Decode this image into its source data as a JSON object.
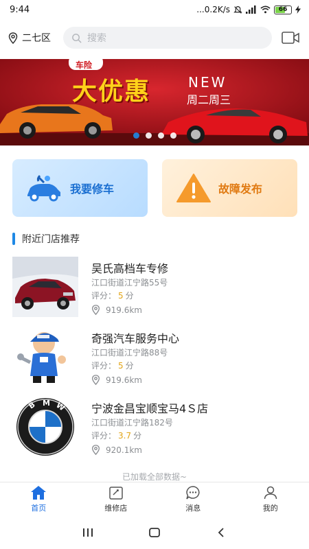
{
  "status": {
    "time": "9:44",
    "speed": "...0.2K/s",
    "battery": "66",
    "battery_level": 0.66
  },
  "topbar": {
    "location": "二七区",
    "search_placeholder": "搜索"
  },
  "banner": {
    "tag": "车险",
    "headline": "大优惠",
    "new_text": "NEW",
    "days": "周二周三",
    "slide_count": 4,
    "active_slide": 0
  },
  "actions": {
    "repair_label": "我要修车",
    "fault_label": "故障发布"
  },
  "section": {
    "title": "附近门店推荐"
  },
  "rating_label": "评分：",
  "rating_unit": "分",
  "shops": [
    {
      "name": "吴氏高档车专修",
      "address": "江口街道江宁路55号",
      "score": "5",
      "distance": "919.6km"
    },
    {
      "name": "奇强汽车服务中心",
      "address": "江口街道江宁路88号",
      "score": "5",
      "distance": "919.6km"
    },
    {
      "name": "宁波金昌宝顺宝马4Ｓ店",
      "address": "江口街道江宁路182号",
      "score": "3.7",
      "distance": "920.1km"
    }
  ],
  "footer_note": "已加载全部数据~",
  "tabs": [
    {
      "label": "首页",
      "icon": "home-icon",
      "active": true
    },
    {
      "label": "维修店",
      "icon": "shop-icon",
      "active": false
    },
    {
      "label": "消息",
      "icon": "message-icon",
      "active": false
    },
    {
      "label": "我的",
      "icon": "profile-icon",
      "active": false
    }
  ],
  "colors": {
    "accent": "#1e88e5",
    "rating": "#e2a518",
    "banner_red": "#b8141c"
  }
}
